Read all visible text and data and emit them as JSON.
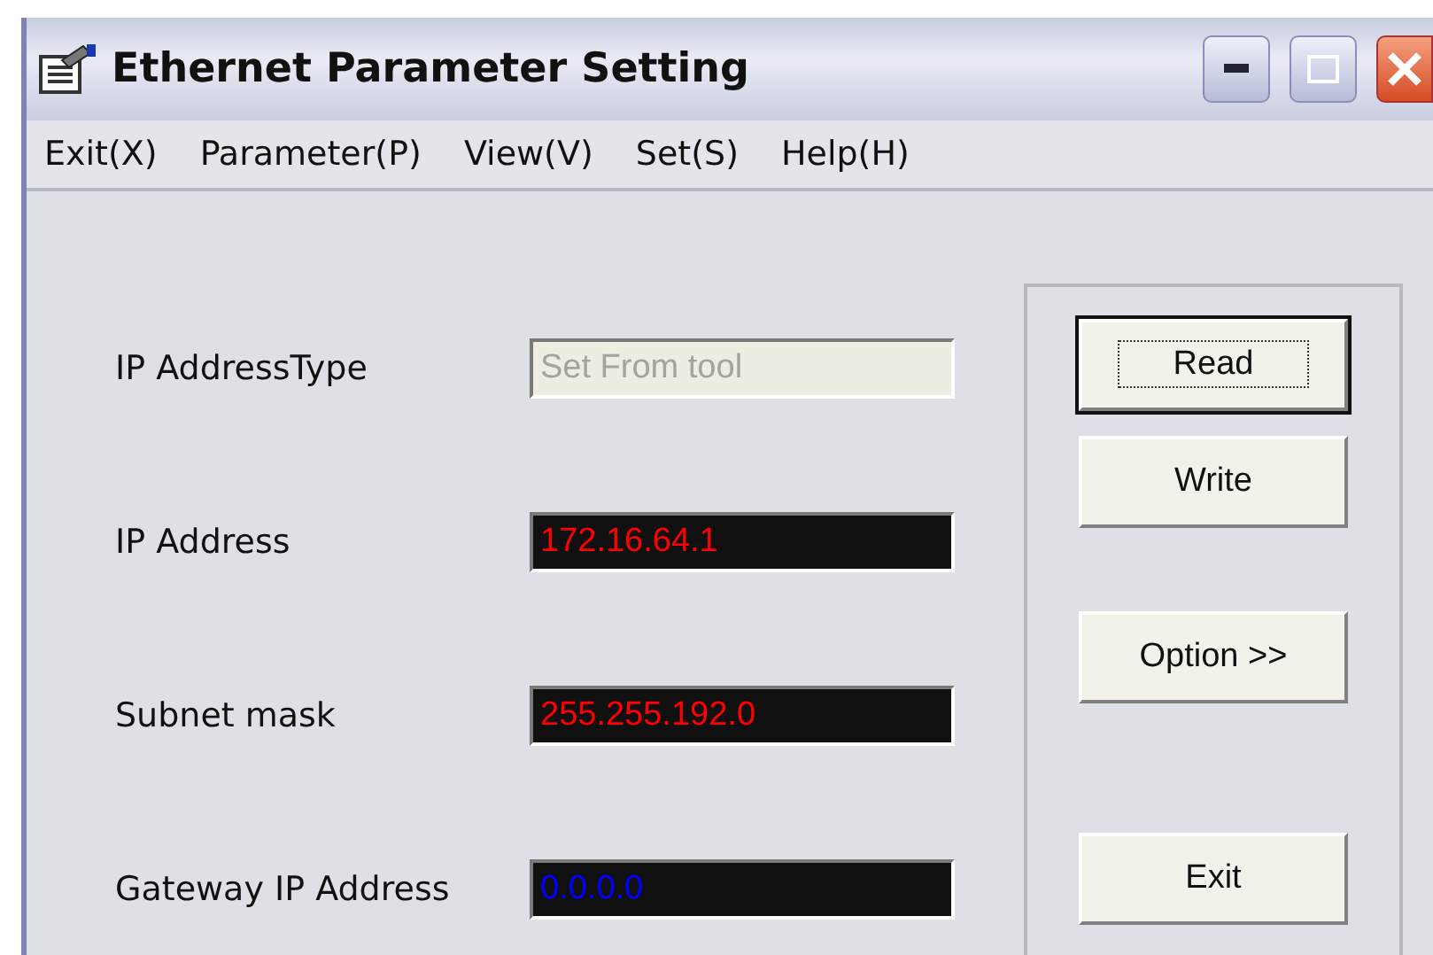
{
  "window": {
    "title": "Ethernet Parameter Setting"
  },
  "menu": [
    "Exit(X)",
    "Parameter(P)",
    "View(V)",
    "Set(S)",
    "Help(H)"
  ],
  "fields": [
    {
      "label": "IP AddressType",
      "value": "Set From tool",
      "kind": "disabled"
    },
    {
      "label": "IP Address",
      "value": "172.16.64.1",
      "kind": "display",
      "color": "#ff0000"
    },
    {
      "label": "Subnet mask",
      "value": "255.255.192.0",
      "kind": "display",
      "color": "#ff0000"
    },
    {
      "label": "Gateway IP Address",
      "value": "0.0.0.0",
      "kind": "display",
      "color": "#0000ff"
    }
  ],
  "buttons": [
    {
      "label": "Read",
      "focused": true
    },
    {
      "label": "Write",
      "focused": false
    },
    {
      "label": "Option >>",
      "focused": false
    },
    {
      "label": "Exit",
      "focused": false
    }
  ]
}
